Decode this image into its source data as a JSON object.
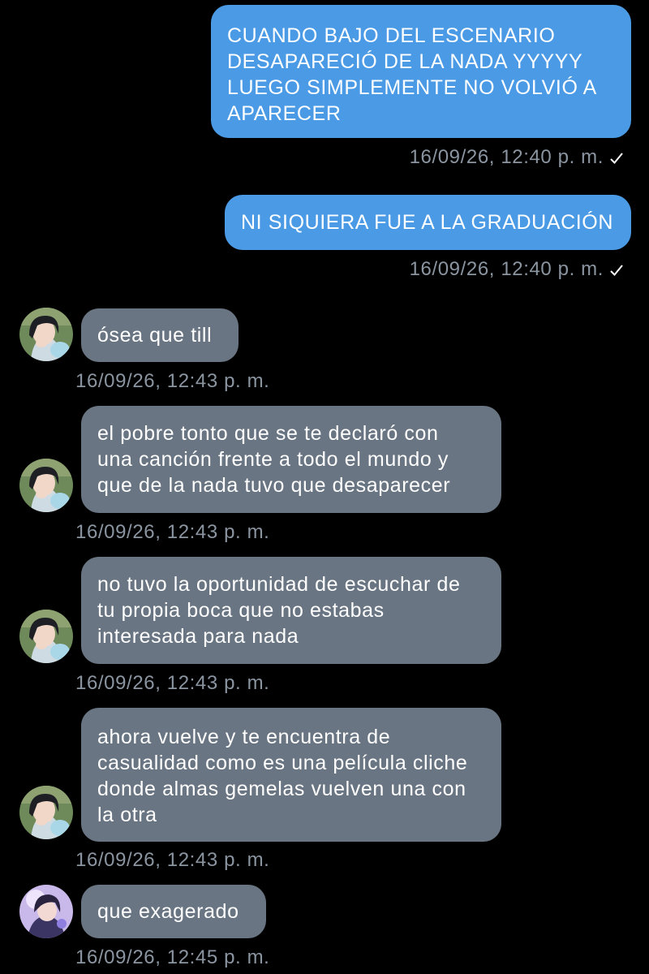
{
  "theme": {
    "background": "#000000",
    "outgoing_bubble": "#4b9ae6",
    "incoming_bubble": "#697582",
    "timestamp_color": "#8b95a1"
  },
  "messages": [
    {
      "direction": "outgoing",
      "text": "CUANDO BAJO DEL ESCENARIO\nDESAPARECIÓ DE LA NADA YYYYY\nLUEGO SIMPLEMENTE NO VOLVIÓ A\nAPARECER",
      "time": "16/09/26, 12:40 p. m.",
      "status_icon": "single-check-icon"
    },
    {
      "direction": "outgoing",
      "text": "NI SIQUIERA FUE A LA GRADUACIÓN",
      "time": "16/09/26, 12:40 p. m.",
      "status_icon": "single-check-icon"
    },
    {
      "direction": "incoming",
      "avatar": "dark-haired-girl-avatar",
      "text": "ósea que till",
      "time": "16/09/26, 12:43 p. m."
    },
    {
      "direction": "incoming",
      "avatar": "dark-haired-girl-avatar",
      "text": "el pobre tonto que se te declaró con\nuna canción frente a todo el mundo y\nque de la nada tuvo que desaparecer",
      "time": "16/09/26, 12:43 p. m."
    },
    {
      "direction": "incoming",
      "avatar": "dark-haired-girl-avatar",
      "text": "no tuvo la oportunidad de escuchar de\ntu propia boca que no estabas\ninteresada para nada",
      "time": "16/09/26, 12:43 p. m."
    },
    {
      "direction": "incoming",
      "avatar": "dark-haired-girl-avatar",
      "text": "ahora vuelve y te encuentra de\ncasualidad como es una película cliche\ndonde almas gemelas vuelven una con\nla otra",
      "time": "16/09/26, 12:43 p. m."
    },
    {
      "direction": "incoming",
      "avatar": "purple-anime-avatar",
      "text": "que exagerado",
      "time": "16/09/26, 12:45 p. m."
    }
  ]
}
